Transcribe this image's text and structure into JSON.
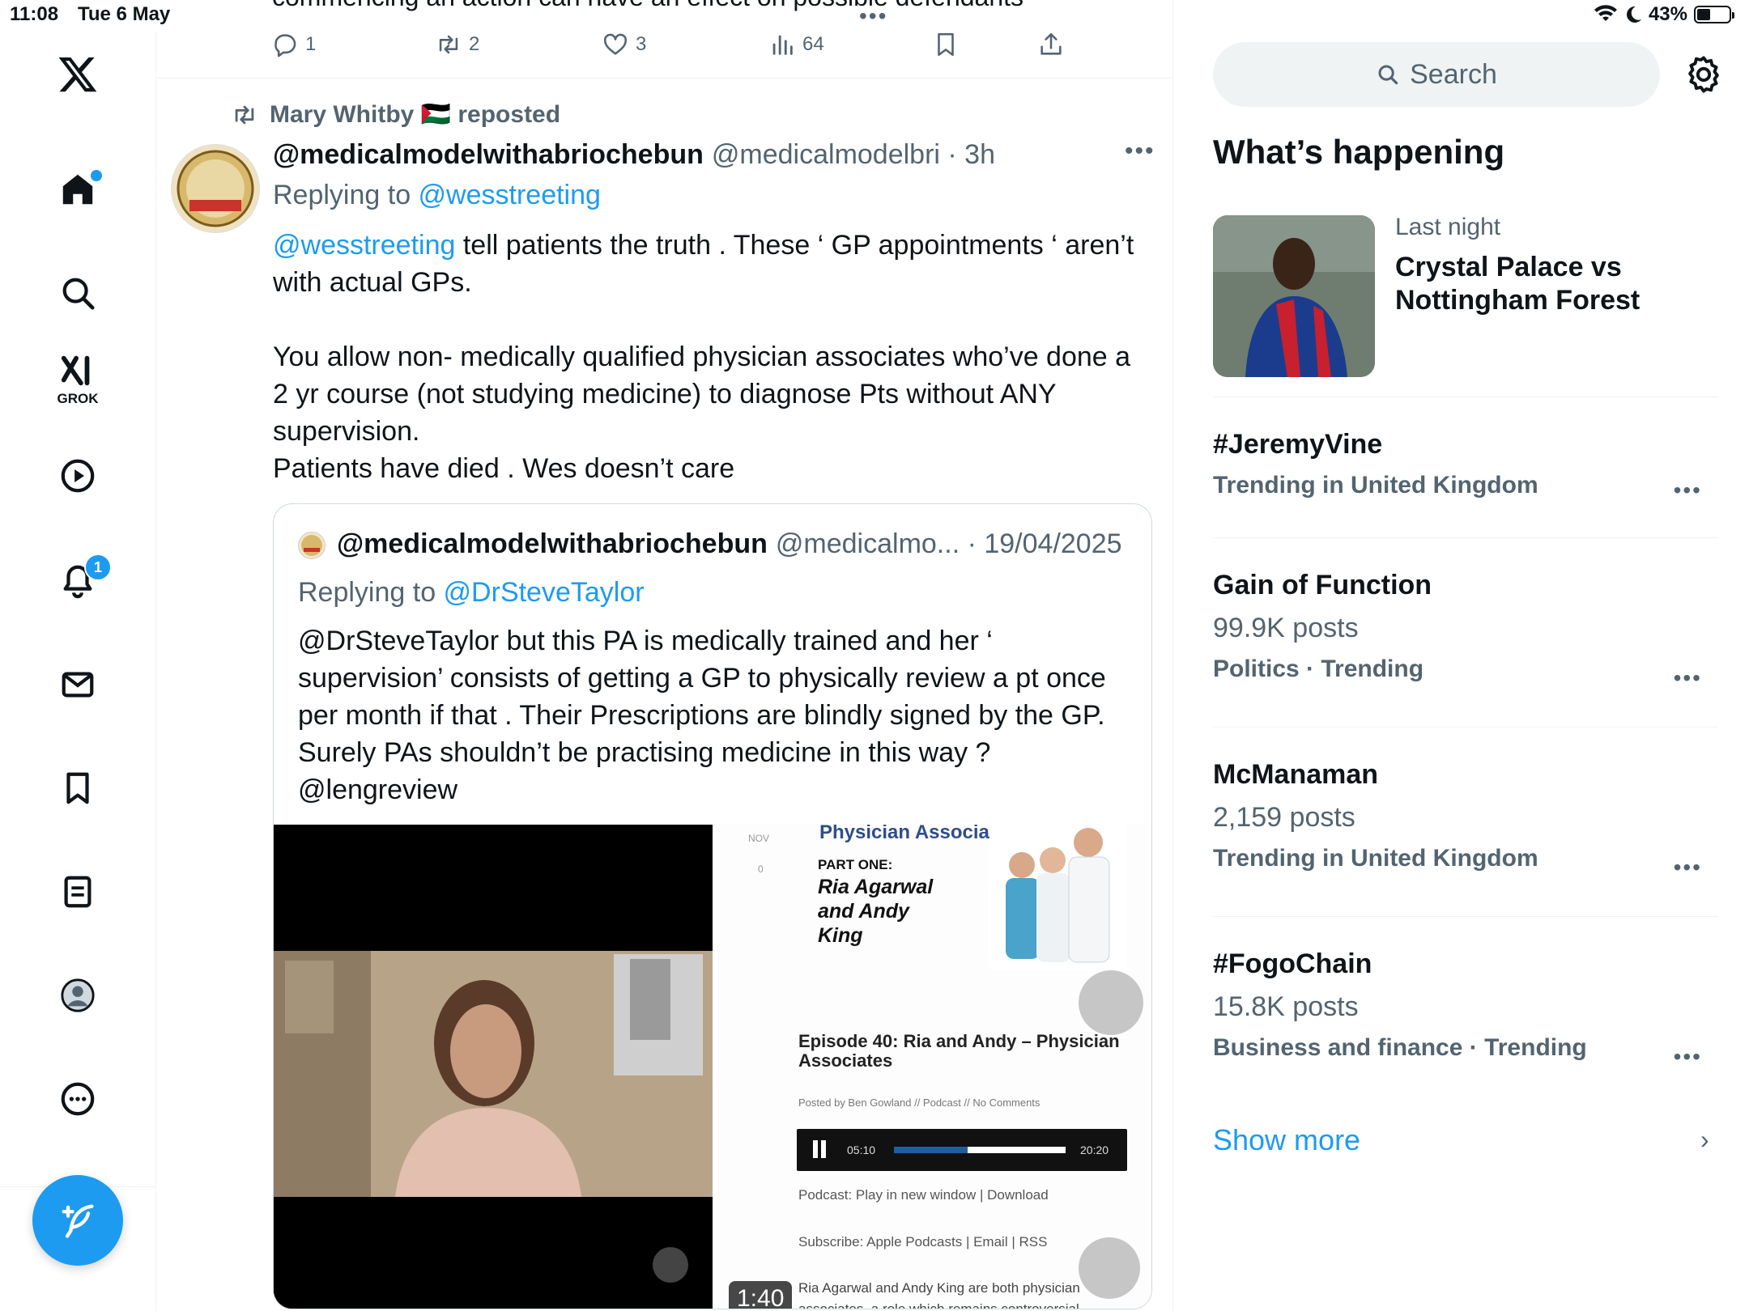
{
  "status_bar": {
    "time": "11:08",
    "date": "Tue 6 May",
    "battery": "43%",
    "battery_level": 0.43
  },
  "nav": {
    "grok_label": "GROK",
    "notifications_count": "1",
    "accent": "#1d9bf0"
  },
  "previous_tweet": {
    "text_fragment": "commencing an action can have an effect on possible defendants",
    "more": "•••",
    "reply_count": "1",
    "retweet_count": "2",
    "like_count": "3",
    "views_count": "64"
  },
  "tweet": {
    "repost_by": "Mary Whitby 🇵🇸 reposted",
    "display_name": "@medicalmodelwithabriochebun",
    "handle_time": "@medicalmodelbri · 3h",
    "more": "•••",
    "replying_prefix": "Replying to ",
    "replying_to": "@wesstreeting",
    "body_mention": "@wesstreeting",
    "body_text": " tell patients the truth . These ‘ GP appointments ‘ aren’t with actual GPs.\n\nYou allow non- medically qualified physician associates who’ve done a 2 yr course (not studying medicine) to diagnose Pts without ANY supervision.\nPatients have died . Wes doesn’t care",
    "avatar_text": [
      "General",
      "Medical",
      "Council",
      "NO",
      "CONFIDENCE"
    ]
  },
  "quoted_tweet": {
    "display_name": "@medicalmodelwithabriochebun",
    "handle_date": "@medicalmo... · 19/04/2025",
    "replying_prefix": "Replying to ",
    "replying_to": "@DrSteveTaylor",
    "body": "@DrSteveTaylor but this PA is medically trained and her ‘ supervision’ consists of getting a GP to physically review a pt once per month if that . Their Prescriptions are blindly signed by the GP. Surely PAs shouldn’t be practising medicine in this way ?\n@lengreview",
    "video_duration": "1:40",
    "podcast_card": {
      "heading": "Physician Associates",
      "date_tag": "NOV",
      "comments_tag": "0",
      "part": "PART ONE:",
      "names": "Ria Agarwal and Andy King",
      "episode_title": "Episode 40: Ria and Andy – Physician Associates",
      "posted_by": "Posted by Ben Gowland // Podcast // No Comments",
      "player_time": "05:10",
      "player_total": "20:20",
      "player_progress": 0.43,
      "podcast_line": "Podcast: Play in new window | Download",
      "subscribe_line": "Subscribe: Apple Podcasts | Email | RSS",
      "blurb": "Ria Agarwal and Andy King are both physician associates, a role which remains controversial"
    }
  },
  "right_panel": {
    "search_placeholder": "Search",
    "whats_happening": "What’s happening",
    "news": {
      "meta": "Last night",
      "title": "Crystal Palace vs Nottingham Forest"
    },
    "trends": [
      {
        "title": "#JeremyVine",
        "posts": "",
        "context": "Trending in United Kingdom"
      },
      {
        "title": "Gain of Function",
        "posts": "99.9K posts",
        "context": "Politics · Trending"
      },
      {
        "title": "McManaman",
        "posts": "2,159 posts",
        "context": "Trending in United Kingdom"
      },
      {
        "title": "#FogoChain",
        "posts": "15.8K posts",
        "context": "Business and finance · Trending"
      }
    ],
    "trend_more": "•••",
    "show_more": "Show more",
    "show_more_chevron": "›"
  }
}
